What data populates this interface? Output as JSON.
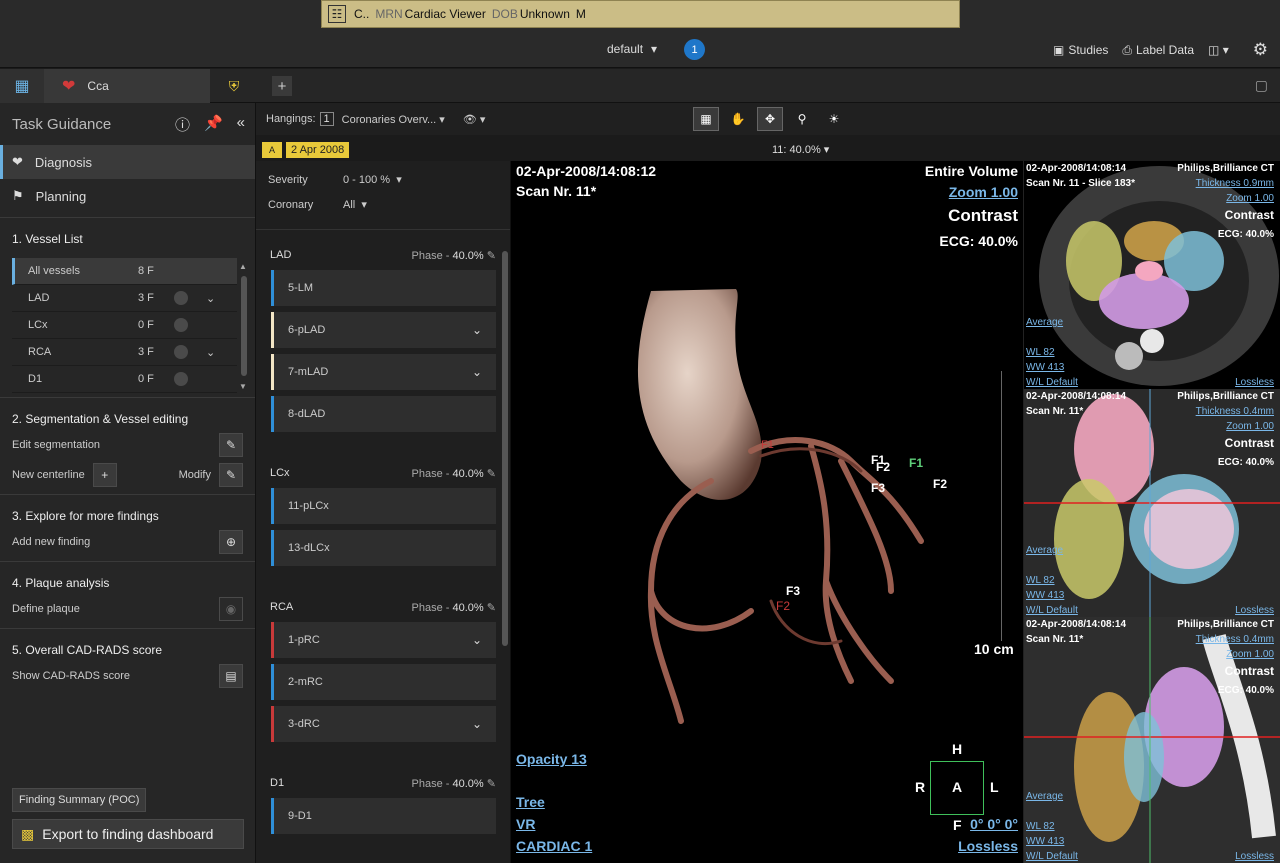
{
  "patient_banner": {
    "name": "C..",
    "mrn_label": "MRN",
    "mrn_value": "Cardiac Viewer",
    "dob_label": "DOB",
    "dob_value": "Unknown",
    "sex": "M"
  },
  "top": {
    "layout_select": "default",
    "badge_count": "1",
    "studies_label": "Studies",
    "label_data_label": "Label Data"
  },
  "tabs": {
    "active_label": "Cca"
  },
  "task_guidance": {
    "title": "Task Guidance",
    "nav": [
      {
        "label": "Diagnosis"
      },
      {
        "label": "Planning"
      }
    ],
    "sections": {
      "vessel_list": "1.  Vessel List",
      "segmentation": "2.  Segmentation & Vessel editing",
      "explore": "3.  Explore for more findings",
      "plaque": "4.  Plaque analysis",
      "cadrads": "5.  Overall CAD-RADS score"
    },
    "vessels": [
      {
        "name": "All vessels",
        "count": "8 F"
      },
      {
        "name": "LAD",
        "count": "3 F"
      },
      {
        "name": "LCx",
        "count": "0 F"
      },
      {
        "name": "RCA",
        "count": "3 F"
      },
      {
        "name": "D1",
        "count": "0 F"
      }
    ],
    "tools": {
      "edit_segmentation": "Edit segmentation",
      "new_centerline": "New centerline",
      "modify": "Modify",
      "add_new_finding": "Add new finding",
      "define_plaque": "Define plaque",
      "show_cadrads": "Show CAD-RADS score"
    },
    "finding_summary": "Finding Summary (POC)",
    "export": "Export to finding dashboard"
  },
  "toolbar": {
    "hangings_label": "Hangings:",
    "hangings_num": "1",
    "hanging_select": "Coronaries Overv...",
    "date_tag": "2 Apr 2008",
    "phase_select": "11: 40.0%"
  },
  "filters": {
    "severity_label": "Severity",
    "severity_value": "0 - 100 %",
    "coronary_label": "Coronary",
    "coronary_value": "All"
  },
  "segments": [
    {
      "vessel": "LAD",
      "phase_label": "Phase - ",
      "phase_value": "40.0%",
      "items": [
        {
          "label": "5-LM",
          "expand": false,
          "color": "#2f8fd8"
        },
        {
          "label": "6-pLAD",
          "expand": true,
          "color": "#f3e6c6"
        },
        {
          "label": "7-mLAD",
          "expand": true,
          "color": "#f3e6c6"
        },
        {
          "label": "8-dLAD",
          "expand": false,
          "color": "#2f8fd8"
        }
      ]
    },
    {
      "vessel": "LCx",
      "phase_label": "Phase - ",
      "phase_value": "40.0%",
      "items": [
        {
          "label": "11-pLCx",
          "expand": false,
          "color": "#2f8fd8"
        },
        {
          "label": "13-dLCx",
          "expand": false,
          "color": "#2f8fd8"
        }
      ]
    },
    {
      "vessel": "RCA",
      "phase_label": "Phase - ",
      "phase_value": "40.0%",
      "items": [
        {
          "label": "1-pRC",
          "expand": true,
          "color": "#c83a3a"
        },
        {
          "label": "2-mRC",
          "expand": false,
          "color": "#2f8fd8"
        },
        {
          "label": "3-dRC",
          "expand": true,
          "color": "#c83a3a"
        }
      ]
    },
    {
      "vessel": "D1",
      "phase_label": "Phase - ",
      "phase_value": "40.0%",
      "items": [
        {
          "label": "9-D1",
          "expand": false,
          "color": "#2f8fd8"
        }
      ]
    }
  ],
  "main_view": {
    "datetime": "02-Apr-2008/14:08:12",
    "scan": "Scan Nr. 11*",
    "volume": "Entire Volume",
    "zoom": "Zoom 1.00",
    "contrast": "Contrast",
    "ecg": "ECG: 40.0%",
    "opacity": "Opacity  13",
    "scale": "10 cm",
    "tree": "Tree",
    "vr": "VR",
    "preset": "CARDIAC 1",
    "orient_h": "H",
    "orient_a": "A",
    "orient_r": "R",
    "orient_l": "L",
    "orient_f": "F",
    "angles": "0° 0° 0°",
    "lossless": "Lossless",
    "markers": [
      "F1",
      "F1",
      "F1",
      "F2",
      "F2",
      "F3",
      "F3",
      "F2"
    ]
  },
  "right_views": [
    {
      "datetime": "02-Apr-2008/14:08:14",
      "scanner": "Philips,Brilliance CT",
      "scan": "Scan Nr. 11 - Slice 183*",
      "thickness": "Thickness 0.9mm",
      "zoom": "Zoom 1.00",
      "contrast": "Contrast",
      "ecg": "ECG: 40.0%",
      "average": "Average",
      "wl": "WL     82",
      "ww": "WW    413",
      "wl_default": "W/L Default",
      "lossless": "Lossless"
    },
    {
      "datetime": "02-Apr-2008/14:08:14",
      "scanner": "Philips,Brilliance CT",
      "scan": "Scan Nr. 11*",
      "thickness": "Thickness 0.4mm",
      "zoom": "Zoom 1.00",
      "contrast": "Contrast",
      "ecg": "ECG: 40.0%",
      "average": "Average",
      "wl": "WL     82",
      "ww": "WW    413",
      "wl_default": "W/L Default",
      "lossless": "Lossless"
    },
    {
      "datetime": "02-Apr-2008/14:08:14",
      "scanner": "Philips,Brilliance CT",
      "scan": "Scan Nr. 11*",
      "thickness": "Thickness 0.4mm",
      "zoom": "Zoom 1.00",
      "contrast": "Contrast",
      "ecg": "ECG: 40.0%",
      "average": "Average",
      "wl": "WL     82",
      "ww": "WW    413",
      "wl_default": "W/L Default",
      "lossless": "Lossless"
    }
  ]
}
